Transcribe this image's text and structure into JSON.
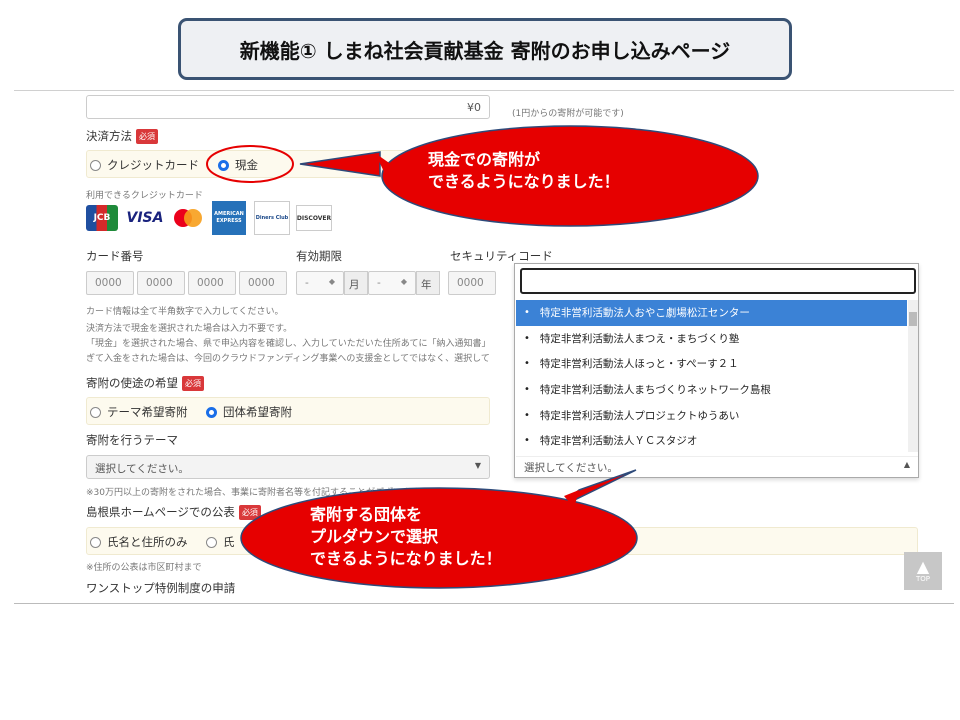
{
  "title": "新機能①  しまね社会貢献基金   寄附のお申し込みページ",
  "amount": {
    "value": "¥0",
    "note": "(1円からの寄附が可能です)"
  },
  "payment": {
    "label": "決済方法",
    "required": "必須",
    "options": [
      "クレジットカード",
      "現金"
    ],
    "selected": "現金",
    "cards_label": "利用できるクレジットカード",
    "cards": [
      "JCB",
      "VISA",
      "mastercard",
      "AMERICAN EXPRESS",
      "Diners Club",
      "DISCOVER"
    ]
  },
  "card": {
    "number_label": "カード番号",
    "number_placeholders": [
      "0000",
      "0000",
      "0000",
      "0000"
    ],
    "expiry_label": "有効期限",
    "expiry_month_placeholder": "-",
    "expiry_month_unit": "月",
    "expiry_year_placeholder": "-",
    "expiry_year_unit": "年",
    "security_label": "セキュリティコード",
    "security_placeholder": "0000",
    "notes": [
      "カード情報は全て半角数字で入力してください。",
      "決済方法で現金を選択された場合は入力不要です。",
      "「現金」を選択された場合、県で申込内容を確認し、入力していただいた住所あてに「納入通知書」",
      "ぎて入金をされた場合は、今回のクラウドファンディング事業への支援金としてではなく、選択して"
    ]
  },
  "usage": {
    "label": "寄附の使途の希望",
    "required": "必須",
    "options": [
      "テーマ希望寄附",
      "団体希望寄附"
    ],
    "selected": "団体希望寄附"
  },
  "theme": {
    "label": "寄附を行うテーマ",
    "placeholder": "選択してください。",
    "note": "※30万円以上の寄附をされた場合、事業に寄附者名等を付記することがございます"
  },
  "publication": {
    "label": "島根県ホームページでの公表",
    "required": "必須",
    "options": [
      "氏名と住所のみ",
      "氏"
    ],
    "note": "※住所の公表は市区町村まで"
  },
  "onestop": {
    "label": "ワンストップ特例制度の申請"
  },
  "dropdown": {
    "items": [
      "特定非営利活動法人おやこ劇場松江センター",
      "特定非営利活動法人まつえ・まちづくり塾",
      "特定非営利活動法人ほっと・すぺーす２１",
      "特定非営利活動法人まちづくりネットワーク島根",
      "特定非営利活動法人プロジェクトゆうあい",
      "特定非営利活動法人ＹＣスタジオ"
    ],
    "active_index": 0,
    "footer": "選択してください。"
  },
  "callouts": {
    "cash": [
      "現金での寄附が",
      "できるようになりました！"
    ],
    "group": [
      "寄附する団体を",
      "プルダウンで選択",
      "できるようになりました！"
    ]
  },
  "top_button": "TOP",
  "colors": {
    "callout": "#e60000",
    "accent": "#1a6ee8",
    "title_border": "#3a5373"
  }
}
